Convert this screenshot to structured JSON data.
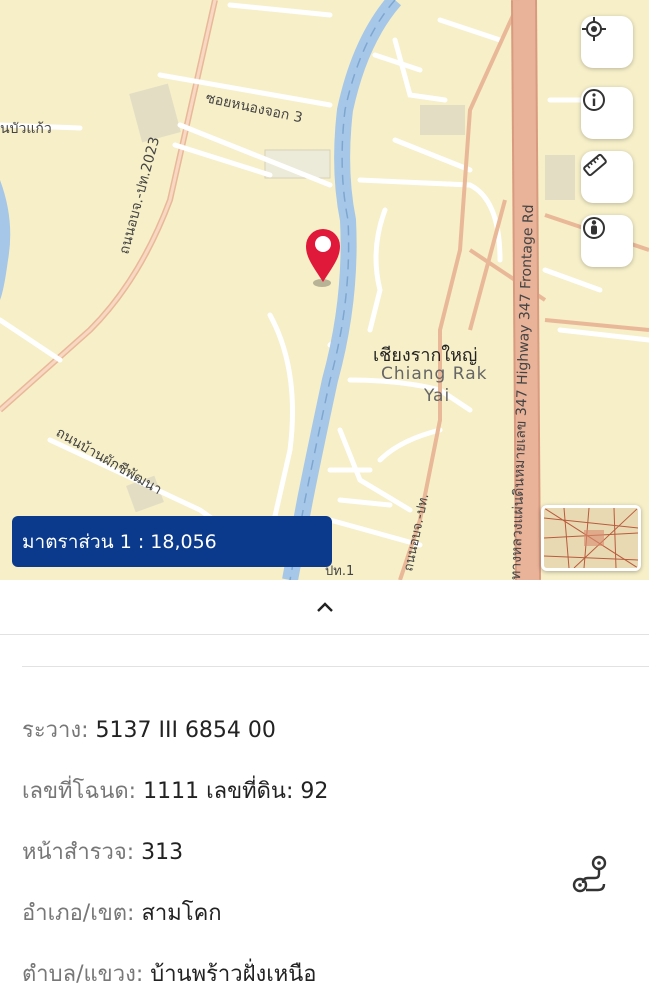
{
  "map": {
    "labels": {
      "road_2023": "ถนนอบจ.-ปท.2023",
      "soi_nong_jok": "ซอยหนองจอก 3",
      "nam_bua_kaeo": "นบัวแก้ว",
      "phak_chi_phatthana": "ถนนบ้านผักชีพัฒนา",
      "highway_347": "ทางหลวงแผ่นดินหมายเลข 347 Highway 347 Frontage Rd",
      "road_pt_bottom": "ถนนอบจ.-ปท.",
      "road_bottom_mid": "ปท.1",
      "town_th": "เชียงรากใหญ่",
      "town_en_1": "Chiang Rak",
      "town_en_2": "Yai"
    },
    "scale_text": "มาตราส่วน 1 : 18,056",
    "colors": {
      "land": "#f6efc8",
      "river": "#a6c7e8",
      "highway": "#e8b399",
      "pin": "#e0193a",
      "scale_bg": "#0b3a8c"
    }
  },
  "controls": {
    "locate_icon": "crosshair-icon",
    "info_icon": "info-icon",
    "measure_icon": "ruler-icon",
    "streetview_icon": "person-icon"
  },
  "sheet": {
    "toggle_icon": "chevron-up-icon",
    "rows": [
      {
        "key": "ระวาง:",
        "value": "5137 III 6854 00"
      },
      {
        "key": "เลขที่โฉนด:",
        "value": "1111 เลขที่ดิน: 92"
      },
      {
        "key": "หน้าสำรวจ:",
        "value": "313"
      },
      {
        "key": "อำเภอ/เขต:",
        "value": "สามโคก"
      },
      {
        "key": "ตำบล/แขวง:",
        "value": "บ้านพร้าวฝั่งเหนือ"
      }
    ],
    "route_icon": "route-icon"
  }
}
